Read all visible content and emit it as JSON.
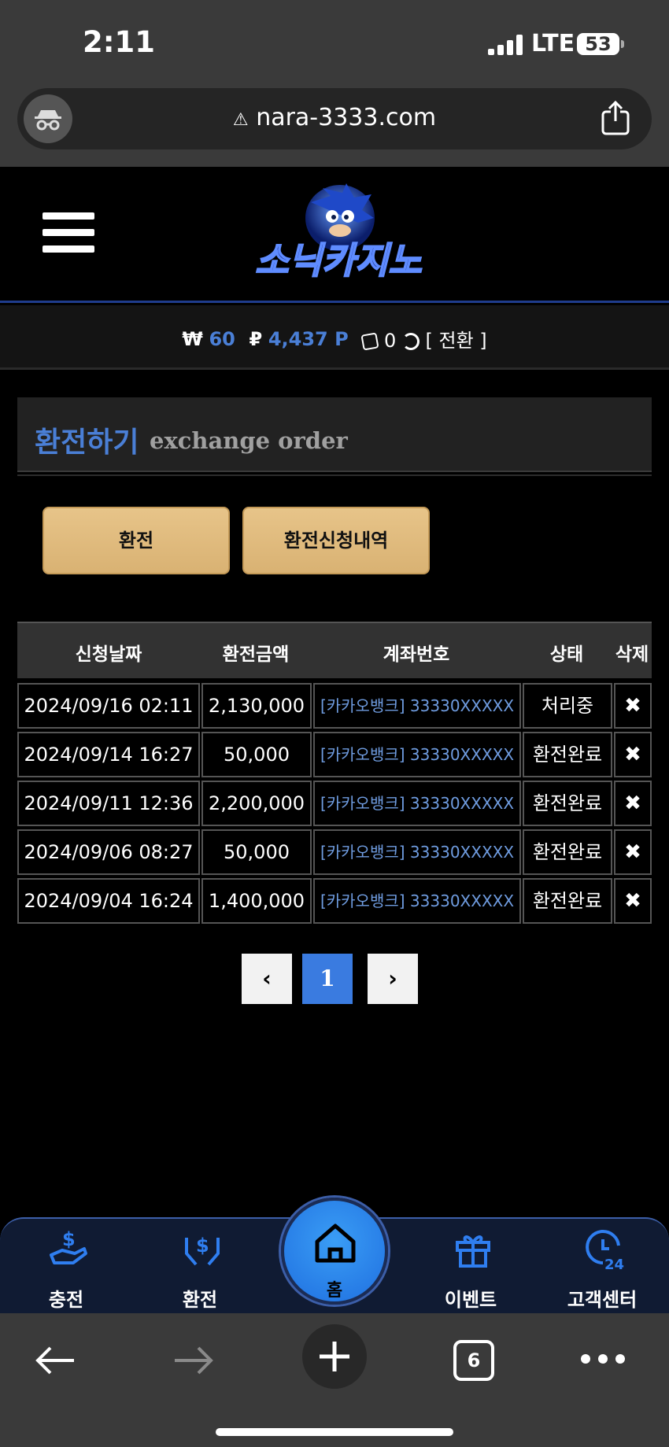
{
  "status_bar": {
    "time": "2:11",
    "network": "LTE",
    "battery": "53"
  },
  "browser": {
    "url": "nara-3333.com",
    "tab_count": "6"
  },
  "header": {
    "logo_text": "소닉카지노"
  },
  "balance": {
    "won_symbol": "₩",
    "won_value": "60",
    "point_symbol": "₽",
    "point_value": "4,437 P",
    "chip_value": "0",
    "convert_label": "[ 전환 ]"
  },
  "page": {
    "title_ko": "환전하기",
    "title_en": "exchange order"
  },
  "buttons": {
    "exchange": "환전",
    "history": "환전신청내역"
  },
  "table": {
    "headers": [
      "신청날짜",
      "환전금액",
      "계좌번호",
      "상태",
      "삭제"
    ],
    "rows": [
      {
        "date": "2024/09/16 02:11",
        "amount": "2,130,000",
        "account": "[카카오뱅크] 33330XXXXX",
        "status": "처리중",
        "delete": "✖"
      },
      {
        "date": "2024/09/14 16:27",
        "amount": "50,000",
        "account": "[카카오뱅크] 33330XXXXX",
        "status": "환전완료",
        "delete": "✖"
      },
      {
        "date": "2024/09/11 12:36",
        "amount": "2,200,000",
        "account": "[카카오뱅크] 33330XXXXX",
        "status": "환전완료",
        "delete": "✖"
      },
      {
        "date": "2024/09/06 08:27",
        "amount": "50,000",
        "account": "[카카오뱅크] 33330XXXXX",
        "status": "환전완료",
        "delete": "✖"
      },
      {
        "date": "2024/09/04 16:24",
        "amount": "1,400,000",
        "account": "[카카오뱅크] 33330XXXXX",
        "status": "환전완료",
        "delete": "✖"
      }
    ]
  },
  "pagination": {
    "prev": "‹",
    "current": "1",
    "next": "›"
  },
  "bottom_nav": {
    "charge": "충전",
    "exchange": "환전",
    "home": "홈",
    "event": "이벤트",
    "support": "고객센터"
  },
  "colors": {
    "accent_blue": "#4a7fd6",
    "button_gold": "#e2bd80",
    "nav_bg": "#101b33"
  }
}
